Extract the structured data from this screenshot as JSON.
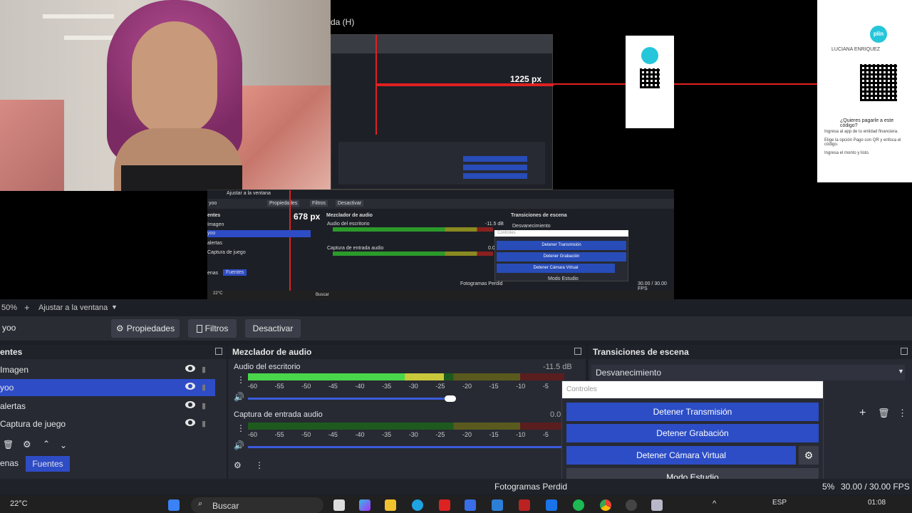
{
  "preview": {
    "nested_title": "da (H)",
    "px_label_1": "1225 px",
    "px_label_2": "678 px",
    "qr_name": "LUCIANA ENRIQUEZ",
    "qr_question": "¿Quieres pagarle a este código?",
    "qr_steps": [
      "Ingresa al app de tu entidad financiera.",
      "Elige la opción Pago con QR y enfoca el código.",
      "Ingresa el monto y listo."
    ],
    "plin_label": "plin",
    "nested_obs": {
      "zoom_label": "Ajustar a la ventana",
      "props": "Propiedades",
      "filters": "Filtros",
      "deactivate": "Desactivar",
      "source": "yoo",
      "sources_title": "entes",
      "sources": [
        "Imagen",
        "yoo",
        "alertas",
        "Captura de juego"
      ],
      "mixer_title": "Mezclador de audio",
      "audio1": "Audio del escritorio",
      "audio1_db": "-11.5 dB",
      "audio2": "Captura de entrada audio",
      "audio2_db": "0.0",
      "transitions_title": "Transiciones de escena",
      "transition": "Desvanecimiento",
      "controls": "Controles",
      "btn_stream": "Detener Transmisión",
      "btn_rec": "Detener Grabación",
      "btn_vcam": "Detener Cámara Virtual",
      "btn_studio": "Modo Estudio",
      "tab_scenes": "enas",
      "tab_sources": "Fuentes",
      "frames": "Fotogramas Perdid",
      "fps": "30.00 / 30.00 FPS",
      "temp": "22°C",
      "search": "Buscar"
    }
  },
  "zoombar": {
    "zoom": "50%",
    "add": "+",
    "label": "Ajustar a la ventana"
  },
  "sourcebar": {
    "source_name": "yoo",
    "properties": "Propiedades",
    "filters": "Filtros",
    "deactivate": "Desactivar"
  },
  "sources_dock": {
    "title": "entes",
    "items": [
      {
        "label": "Imagen",
        "selected": false
      },
      {
        "label": "yoo",
        "selected": true
      },
      {
        "label": "alertas",
        "selected": false
      },
      {
        "label": "Captura de juego",
        "selected": false
      }
    ],
    "tab_scenes": "enas",
    "tab_sources": "Fuentes"
  },
  "mixer": {
    "title": "Mezclador de audio",
    "channels": [
      {
        "name": "Audio del escritorio",
        "db": "-11.5 dB",
        "level": 0.62,
        "volume": 0.8
      },
      {
        "name": "Captura de entrada audio",
        "db": "0.0",
        "level": 0.0,
        "volume": 1.0
      }
    ],
    "ticks": [
      "-60",
      "-55",
      "-50",
      "-45",
      "-40",
      "-35",
      "-30",
      "-25",
      "-20",
      "-15",
      "-10",
      "-5"
    ]
  },
  "transitions": {
    "title": "Transiciones de escena",
    "selected": "Desvanecimiento"
  },
  "controls": {
    "title": "Controles",
    "stream": "Detener Transmisión",
    "recording": "Detener Grabación",
    "virtual_cam": "Detener Cámara Virtual",
    "studio": "Modo Estudio"
  },
  "status": {
    "dropped_frames": "Fotogramas Perdid",
    "cpu": "5%",
    "fps": "30.00 / 30.00 FPS"
  },
  "taskbar": {
    "weather": "22°C",
    "search": "Buscar",
    "lang": "ESP",
    "time": "01:08"
  },
  "colors": {
    "accent": "#2e4cc6",
    "bg": "#1d1f26",
    "panel": "#272a33",
    "recording": "#e02020"
  }
}
